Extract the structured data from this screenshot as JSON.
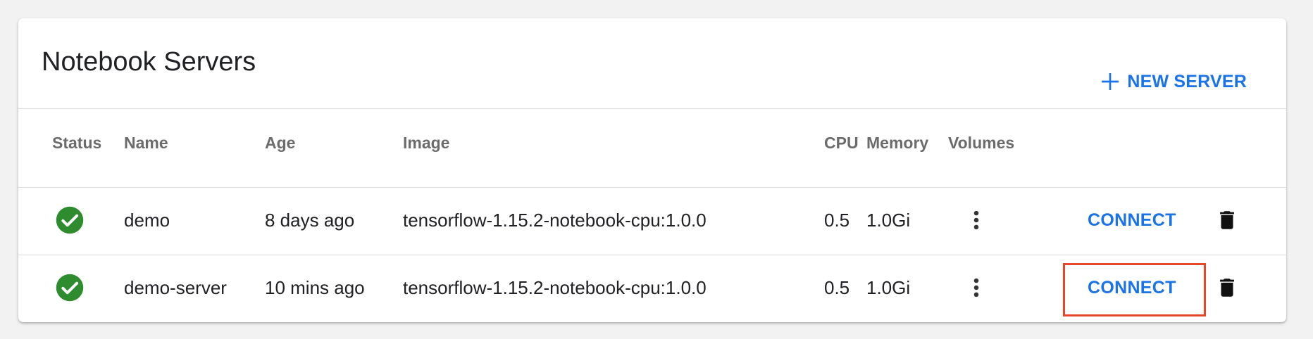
{
  "page": {
    "title": "Notebook Servers",
    "new_server_label": "NEW SERVER"
  },
  "table": {
    "headers": {
      "status": "Status",
      "name": "Name",
      "age": "Age",
      "image": "Image",
      "cpu": "CPU",
      "memory": "Memory",
      "volumes": "Volumes"
    },
    "rows": [
      {
        "status_icon": "check-circle-icon",
        "name": "demo",
        "age": "8 days ago",
        "image": "tensorflow-1.15.2-notebook-cpu:1.0.0",
        "cpu": "0.5",
        "memory": "1.0Gi",
        "connect_label": "CONNECT"
      },
      {
        "status_icon": "check-circle-icon",
        "name": "demo-server",
        "age": "10 mins ago",
        "image": "tensorflow-1.15.2-notebook-cpu:1.0.0",
        "cpu": "0.5",
        "memory": "1.0Gi",
        "connect_label": "CONNECT"
      }
    ]
  },
  "colors": {
    "accent": "#1a73e8",
    "status_ok": "#2e8b2e",
    "highlight": "#e8462a"
  }
}
